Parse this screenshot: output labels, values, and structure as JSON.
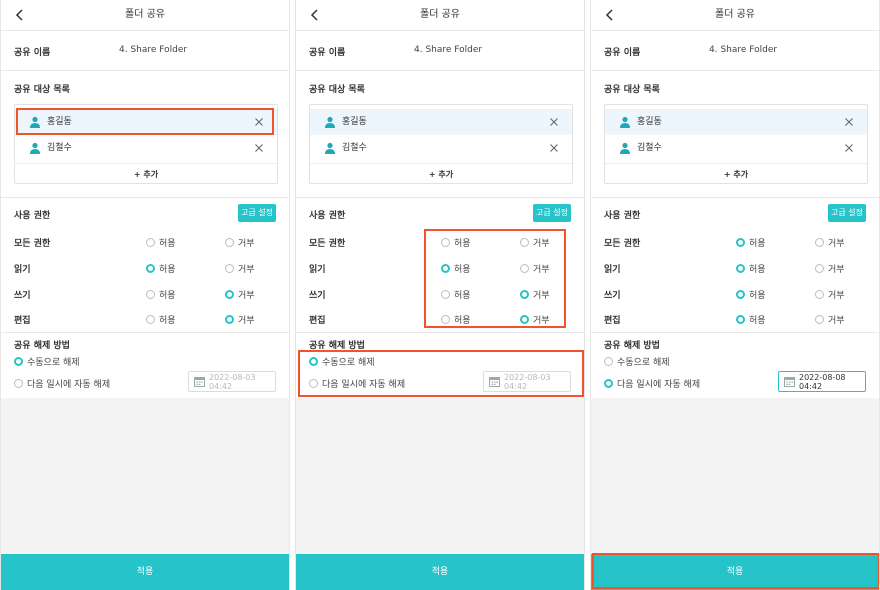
{
  "header": {
    "title": "폴더 공유",
    "back_icon": "chevron-left-icon"
  },
  "share_name": {
    "label": "공유 이름",
    "value": "4. Share Folder"
  },
  "share_targets": {
    "label": "공유 대상 목록",
    "users": [
      {
        "name": "홍길동"
      },
      {
        "name": "김철수"
      }
    ],
    "add_label": "+ 추가"
  },
  "permissions": {
    "label": "사용 권한",
    "advanced_label": "고급 설정",
    "allow_label": "허용",
    "deny_label": "거부",
    "rows": [
      {
        "label": "모든 권한"
      },
      {
        "label": "읽기"
      },
      {
        "label": "쓰기"
      },
      {
        "label": "편집"
      }
    ]
  },
  "release": {
    "label": "공유 해제 방법",
    "manual_label": "수동으로 해제",
    "auto_label": "다음 일시에 자동 해제"
  },
  "apply_label": "적용",
  "panels": [
    {
      "selected_user": 0,
      "permission_values": [
        "none",
        "allow",
        "deny",
        "deny"
      ],
      "release_mode": "manual",
      "date": "2022-08-03 04:42",
      "highlights": [
        "user-row-0"
      ]
    },
    {
      "selected_user": 0,
      "permission_values": [
        "none",
        "allow",
        "deny",
        "deny"
      ],
      "release_mode": "manual",
      "date": "2022-08-03 04:42",
      "highlights": [
        "permissions",
        "release"
      ]
    },
    {
      "selected_user": 0,
      "permission_values": [
        "allow",
        "allow",
        "allow",
        "allow"
      ],
      "release_mode": "auto",
      "date": "2022-08-08 04:42",
      "highlights": [
        "apply"
      ]
    }
  ],
  "colors": {
    "accent": "#26c3c8",
    "highlight": "#f0542d",
    "selected_row": "#eef6fd"
  }
}
